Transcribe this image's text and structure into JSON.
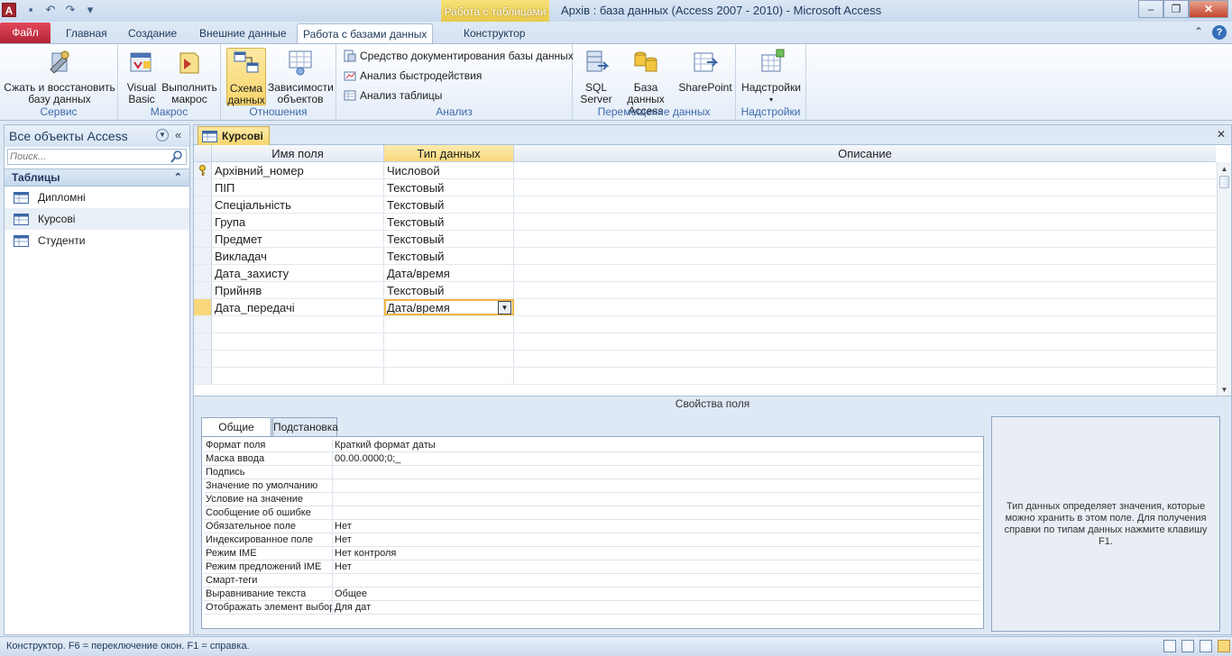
{
  "titlebar": {
    "app_icon_letter": "A",
    "context_label": "Работа с таблицами",
    "title": "Архів : база данных (Access 2007 - 2010)  -  Microsoft Access"
  },
  "tabs": {
    "file": "Файл",
    "items": [
      "Главная",
      "Создание",
      "Внешние данные",
      "Работа с базами данных",
      "Конструктор"
    ]
  },
  "ribbon": {
    "groups": {
      "service": "Сервис",
      "macro": "Макрос",
      "relations": "Отношения",
      "analysis": "Анализ",
      "move": "Перемещение данных",
      "addins": "Надстройки"
    },
    "buttons": {
      "compact": "Сжать и восстановить базу данных",
      "vba": "Visual Basic",
      "run_macro": "Выполнить макрос",
      "schema": "Схема данных",
      "dependencies": "Зависимости объектов",
      "documenter": "Средство документирования базы данных",
      "perf": "Анализ быстродействия",
      "table_analysis": "Анализ таблицы",
      "sql": "SQL Server",
      "access_db": "База данных Access",
      "sharepoint": "SharePoint",
      "addins": "Надстройки"
    }
  },
  "nav": {
    "title": "Все объекты Access",
    "search_placeholder": "Поиск...",
    "group": "Таблицы",
    "items": [
      "Дипломні",
      "Курсові",
      "Студенти"
    ]
  },
  "doc": {
    "tab": "Курсові",
    "headers": [
      "Имя поля",
      "Тип данных",
      "Описание"
    ],
    "rows": [
      {
        "name": "Архівний_номер",
        "type": "Числовой"
      },
      {
        "name": "ПІП",
        "type": "Текстовый"
      },
      {
        "name": "Спеціальність",
        "type": "Текстовый"
      },
      {
        "name": "Група",
        "type": "Текстовый"
      },
      {
        "name": "Предмет",
        "type": "Текстовый"
      },
      {
        "name": "Викладач",
        "type": "Текстовый"
      },
      {
        "name": "Дата_захисту",
        "type": "Дата/время"
      },
      {
        "name": "Прийняв",
        "type": "Текстовый"
      },
      {
        "name": "Дата_передачі",
        "type": "Дата/время"
      }
    ]
  },
  "props": {
    "title": "Свойства поля",
    "tabs": [
      "Общие",
      "Подстановка"
    ],
    "rows": [
      {
        "label": "Формат поля",
        "value": "Краткий формат даты"
      },
      {
        "label": "Маска ввода",
        "value": "00.00.0000;0;_"
      },
      {
        "label": "Подпись",
        "value": ""
      },
      {
        "label": "Значение по умолчанию",
        "value": ""
      },
      {
        "label": "Условие на значение",
        "value": ""
      },
      {
        "label": "Сообщение об ошибке",
        "value": ""
      },
      {
        "label": "Обязательное поле",
        "value": "Нет"
      },
      {
        "label": "Индексированное поле",
        "value": "Нет"
      },
      {
        "label": "Режим IME",
        "value": "Нет контроля"
      },
      {
        "label": "Режим предложений IME",
        "value": "Нет"
      },
      {
        "label": "Смарт-теги",
        "value": ""
      },
      {
        "label": "Выравнивание текста",
        "value": "Общее"
      },
      {
        "label": "Отображать элемент выбора даты",
        "value": "Для дат"
      }
    ],
    "help": "Тип данных определяет значения, которые можно хранить в этом поле. Для получения справки по типам данных нажмите клавишу F1."
  },
  "status": {
    "text": "Конструктор.  F6 = переключение окон.  F1 = справка."
  }
}
